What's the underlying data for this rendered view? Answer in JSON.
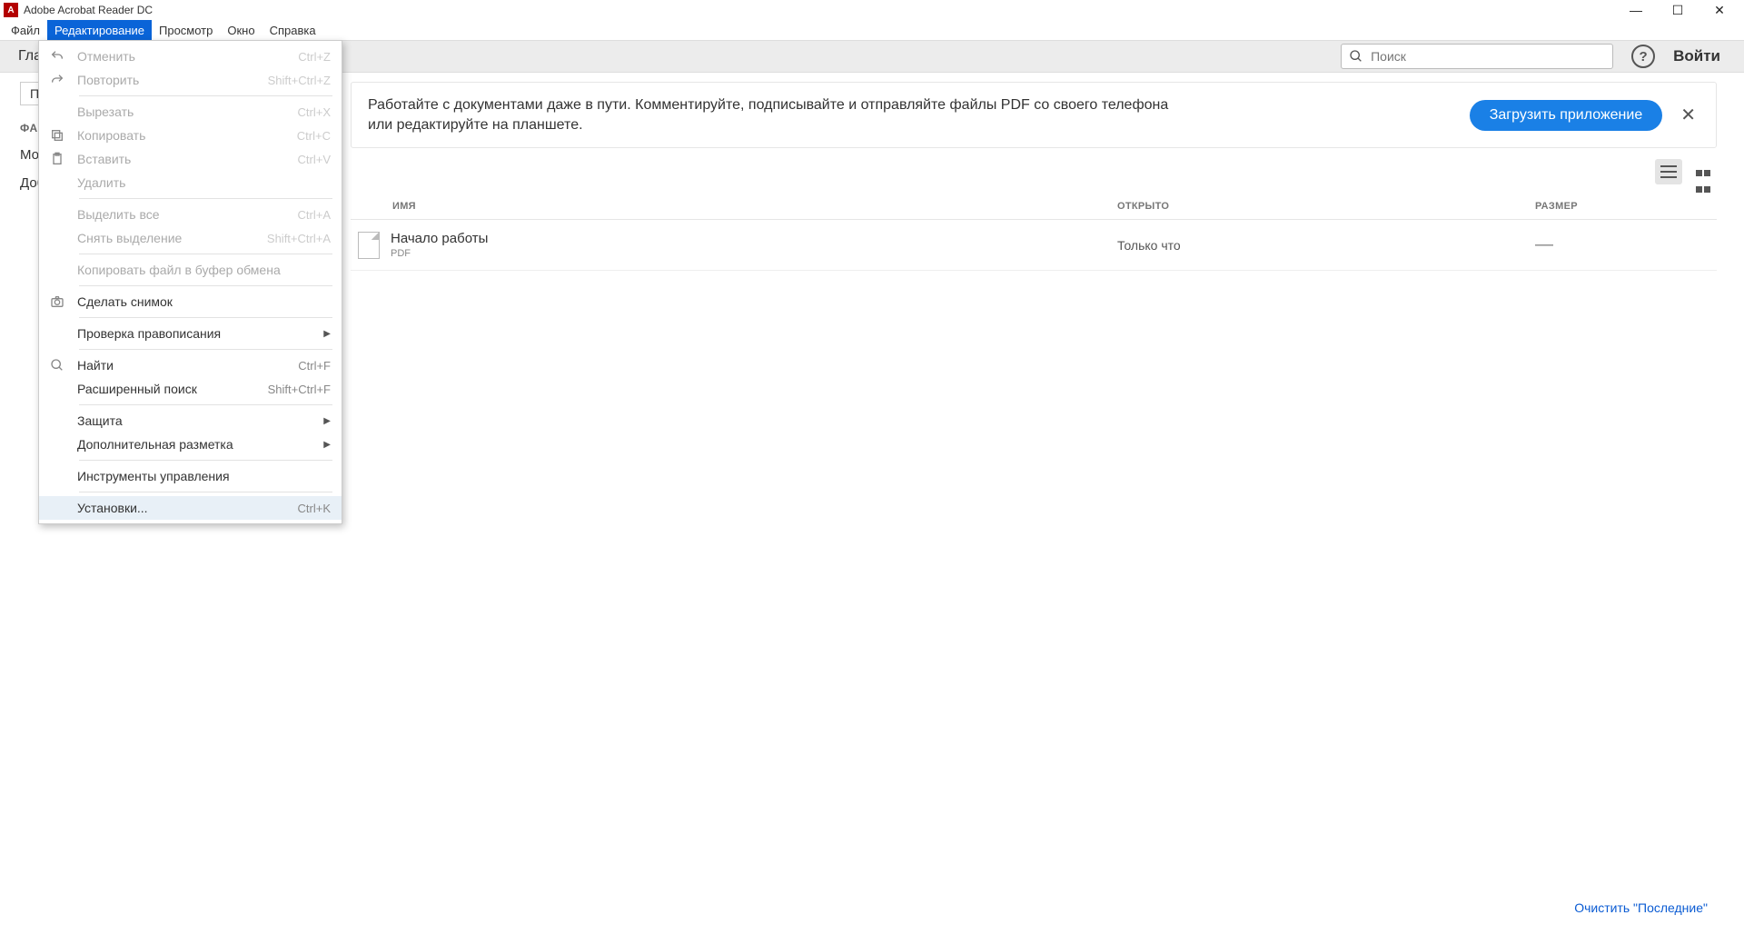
{
  "window": {
    "title": "Adobe Acrobat Reader DC"
  },
  "menubar": {
    "items": [
      {
        "label": "Файл"
      },
      {
        "label": "Редактирование"
      },
      {
        "label": "Просмотр"
      },
      {
        "label": "Окно"
      },
      {
        "label": "Справка"
      }
    ],
    "active_index": 1
  },
  "topbar": {
    "home_tab": "Главная",
    "search_placeholder": "Поиск",
    "sign_in": "Войти"
  },
  "sidebar": {
    "recent_btn": "Последние",
    "section_files": "ФАЙЛЫ",
    "items": [
      "Мой компьютер",
      "Добавить учетную"
    ]
  },
  "promo": {
    "text_line1": "Работайте с документами даже в пути. Комментируйте, подписывайте и отправляйте файлы PDF со своего телефона",
    "text_line2": "или редактируйте на планшете.",
    "button": "Загрузить приложение"
  },
  "table": {
    "col_name": "ИМЯ",
    "col_opened": "ОТКРЫТО",
    "col_size": "РАЗМЕР",
    "rows": [
      {
        "name": "Начало работы",
        "type": "PDF",
        "opened": "Только что",
        "size": "—"
      }
    ]
  },
  "footer": {
    "clear_recent": "Очистить \"Последние\""
  },
  "edit_menu": {
    "items": [
      {
        "label": "Отменить",
        "shortcut": "Ctrl+Z",
        "disabled": true,
        "icon": "undo"
      },
      {
        "label": "Повторить",
        "shortcut": "Shift+Ctrl+Z",
        "disabled": true,
        "icon": "redo"
      },
      {
        "sep": true
      },
      {
        "label": "Вырезать",
        "shortcut": "Ctrl+X",
        "disabled": true
      },
      {
        "label": "Копировать",
        "shortcut": "Ctrl+C",
        "disabled": true,
        "icon": "copy"
      },
      {
        "label": "Вставить",
        "shortcut": "Ctrl+V",
        "disabled": true,
        "icon": "paste"
      },
      {
        "label": "Удалить",
        "shortcut": "",
        "disabled": true
      },
      {
        "sep": true
      },
      {
        "label": "Выделить все",
        "shortcut": "Ctrl+A",
        "disabled": true
      },
      {
        "label": "Снять выделение",
        "shortcut": "Shift+Ctrl+A",
        "disabled": true
      },
      {
        "sep": true
      },
      {
        "label": "Копировать файл в буфер обмена",
        "shortcut": "",
        "disabled": true
      },
      {
        "sep": true
      },
      {
        "label": "Сделать снимок",
        "shortcut": "",
        "disabled": false,
        "icon": "camera"
      },
      {
        "sep": true
      },
      {
        "label": "Проверка правописания",
        "shortcut": "",
        "disabled": false,
        "submenu": true
      },
      {
        "sep": true
      },
      {
        "label": "Найти",
        "shortcut": "Ctrl+F",
        "disabled": false,
        "icon": "search"
      },
      {
        "label": "Расширенный поиск",
        "shortcut": "Shift+Ctrl+F",
        "disabled": false
      },
      {
        "sep": true
      },
      {
        "label": "Защита",
        "shortcut": "",
        "disabled": false,
        "submenu": true
      },
      {
        "label": "Дополнительная разметка",
        "shortcut": "",
        "disabled": false,
        "submenu": true
      },
      {
        "sep": true
      },
      {
        "label": "Инструменты управления",
        "shortcut": "",
        "disabled": false
      },
      {
        "sep": true
      },
      {
        "label": "Установки...",
        "shortcut": "Ctrl+K",
        "disabled": false,
        "hover": true
      }
    ]
  }
}
